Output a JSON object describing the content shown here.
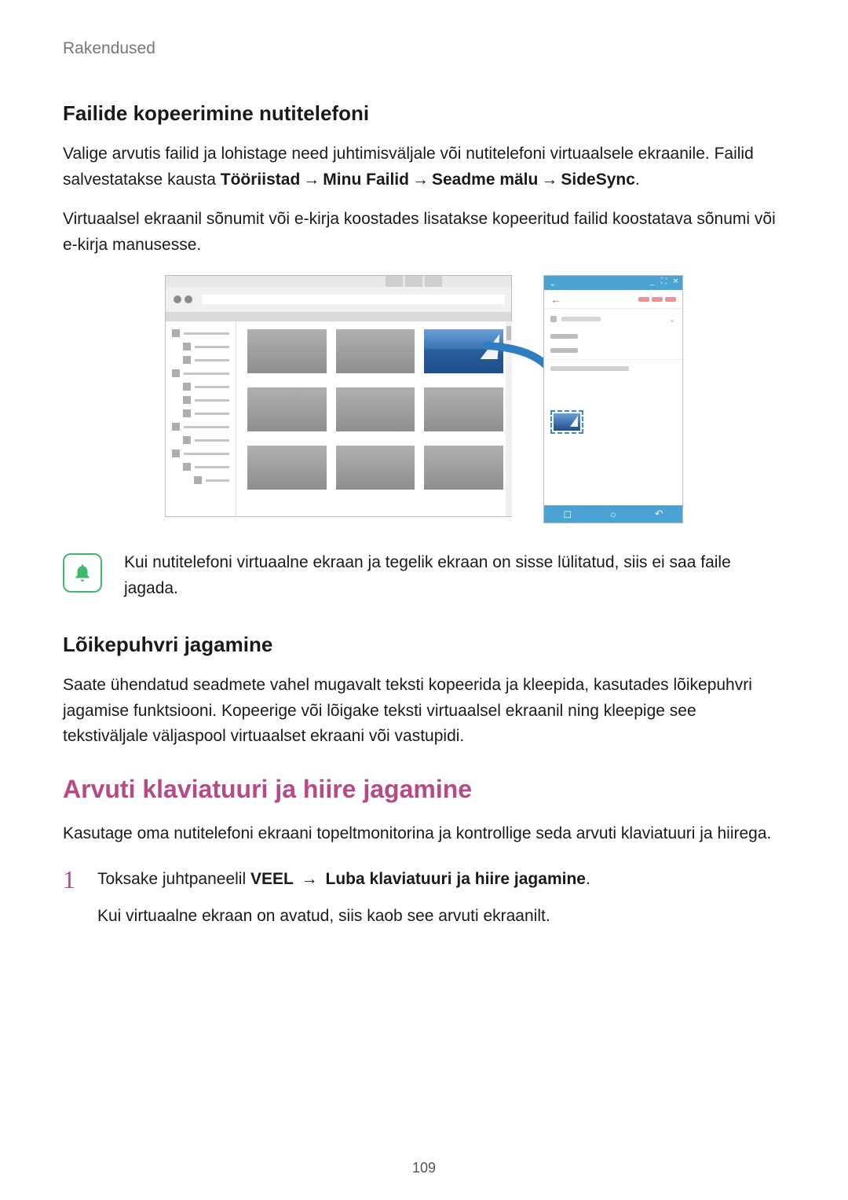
{
  "breadcrumb": "Rakendused",
  "section_copy": {
    "heading": "Failide kopeerimine nutitelefoni",
    "p1_pre": "Valige arvutis failid ja lohistage need juhtimisväljale või nutitelefoni virtuaalsele ekraanile. Failid salvestatakse kausta ",
    "path": [
      "Tööriistad",
      "Minu Failid",
      "Seadme mälu",
      "SideSync"
    ],
    "arrow": "→",
    "p1_post": ".",
    "p2": "Virtuaalsel ekraanil sõnumit või e-kirja koostades lisatakse kopeeritud failid koostatava sõnumi või e-kirja manusesse."
  },
  "info_note": "Kui nutitelefoni virtuaalne ekraan ja tegelik ekraan on sisse lülitatud, siis ei saa faile jagada.",
  "section_clipboard": {
    "heading": "Lõikepuhvri jagamine",
    "p": "Saate ühendatud seadmete vahel mugavalt teksti kopeerida ja kleepida, kasutades lõikepuhvri jagamise funktsiooni. Kopeerige või lõigake teksti virtuaalsel ekraanil ning kleepige see tekstiväljale väljaspool virtuaalset ekraani või vastupidi."
  },
  "section_kbmouse": {
    "heading": "Arvuti klaviatuuri ja hiire jagamine",
    "intro": "Kasutage oma nutitelefoni ekraani topeltmonitorina ja kontrollige seda arvuti klaviatuuri ja hiirega.",
    "steps": [
      {
        "num": "1",
        "line1_pre": "Toksake juhtpaneelil ",
        "line1_bold1": "VEEL",
        "line1_arrow": "→",
        "line1_bold2": "Luba klaviatuuri ja hiire jagamine",
        "line1_post": ".",
        "line2": "Kui virtuaalne ekraan on avatud, siis kaob see arvuti ekraanilt."
      }
    ]
  },
  "phone_nav": {
    "recent": "◻",
    "home": "○",
    "back": "↶"
  },
  "page_number": "109"
}
